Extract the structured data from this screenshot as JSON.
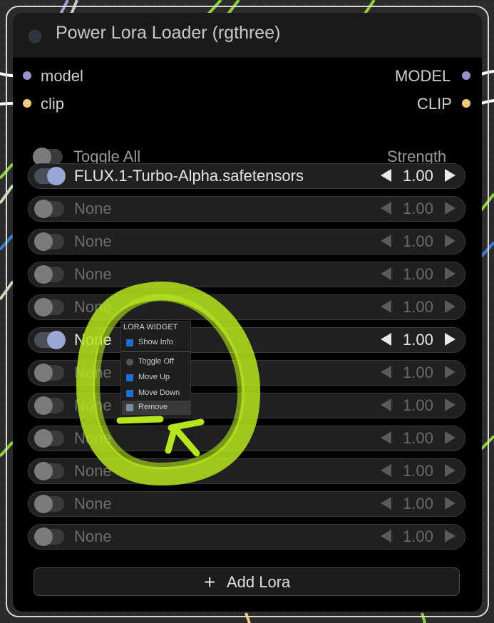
{
  "node": {
    "title": "Power Lora Loader (rgthree)",
    "inputs": [
      {
        "label": "model",
        "color": "#9b8fc7"
      },
      {
        "label": "clip",
        "color": "#f0c97a"
      }
    ],
    "outputs": [
      {
        "label": "MODEL",
        "color": "#9b8fc7"
      },
      {
        "label": "CLIP",
        "color": "#f0c97a"
      }
    ],
    "toggle_all_label": "Toggle All",
    "strength_header": "Strength",
    "loras": [
      {
        "name": "FLUX.1-Turbo-Alpha.safetensors",
        "strength": "1.00",
        "enabled": true
      },
      {
        "name": "None",
        "strength": "1.00",
        "enabled": false
      },
      {
        "name": "None",
        "strength": "1.00",
        "enabled": false
      },
      {
        "name": "None",
        "strength": "1.00",
        "enabled": false
      },
      {
        "name": "None",
        "strength": "1.00",
        "enabled": false
      },
      {
        "name": "None",
        "strength": "1.00",
        "enabled": true
      },
      {
        "name": "None",
        "strength": "1.00",
        "enabled": false
      },
      {
        "name": "None",
        "strength": "1.00",
        "enabled": false
      },
      {
        "name": "None",
        "strength": "1.00",
        "enabled": false
      },
      {
        "name": "None",
        "strength": "1.00",
        "enabled": false
      },
      {
        "name": "None",
        "strength": "1.00",
        "enabled": false
      },
      {
        "name": "None",
        "strength": "1.00",
        "enabled": false
      }
    ],
    "add_lora_label": "Add Lora"
  },
  "context_menu": {
    "title": "LORA WIDGET",
    "items": [
      {
        "label": "Show Info",
        "icon": "info-icon"
      },
      {
        "label": "Toggle Off",
        "icon": "toggle-dot-icon"
      },
      {
        "label": "Move Up",
        "icon": "arrow-up-icon"
      },
      {
        "label": "Move Down",
        "icon": "arrow-down-icon"
      },
      {
        "label": "Remove",
        "icon": "trash-icon"
      }
    ]
  },
  "annotation": {
    "color": "#b5e61d"
  },
  "colors": {
    "accent_toggle": "#9aa7d6",
    "node_bg": "#000000",
    "title_bg": "#1a1a1a"
  }
}
